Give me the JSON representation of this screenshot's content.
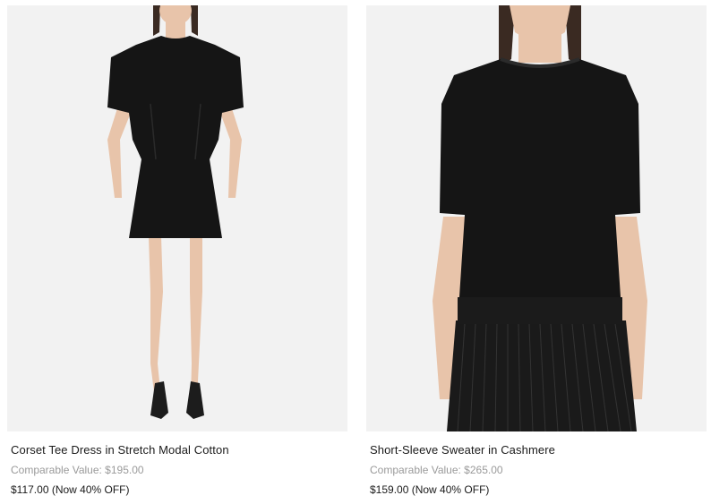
{
  "products": [
    {
      "name": "Corset Tee Dress in Stretch Modal Cotton",
      "comparable": "Comparable Value: $195.00",
      "price": "$117.00 (Now 40% OFF)",
      "image_icon": "model-wearing-black-dress"
    },
    {
      "name": "Short-Sleeve Sweater in Cashmere",
      "comparable": "Comparable Value: $265.00",
      "price": "$159.00 (Now 40% OFF)",
      "image_icon": "model-wearing-black-sweater"
    }
  ],
  "colors": {
    "image_bg": "#f2f2f2",
    "garment": "#151515",
    "skin": "#e8c4aa",
    "comparable_text": "#9a9a9a"
  }
}
